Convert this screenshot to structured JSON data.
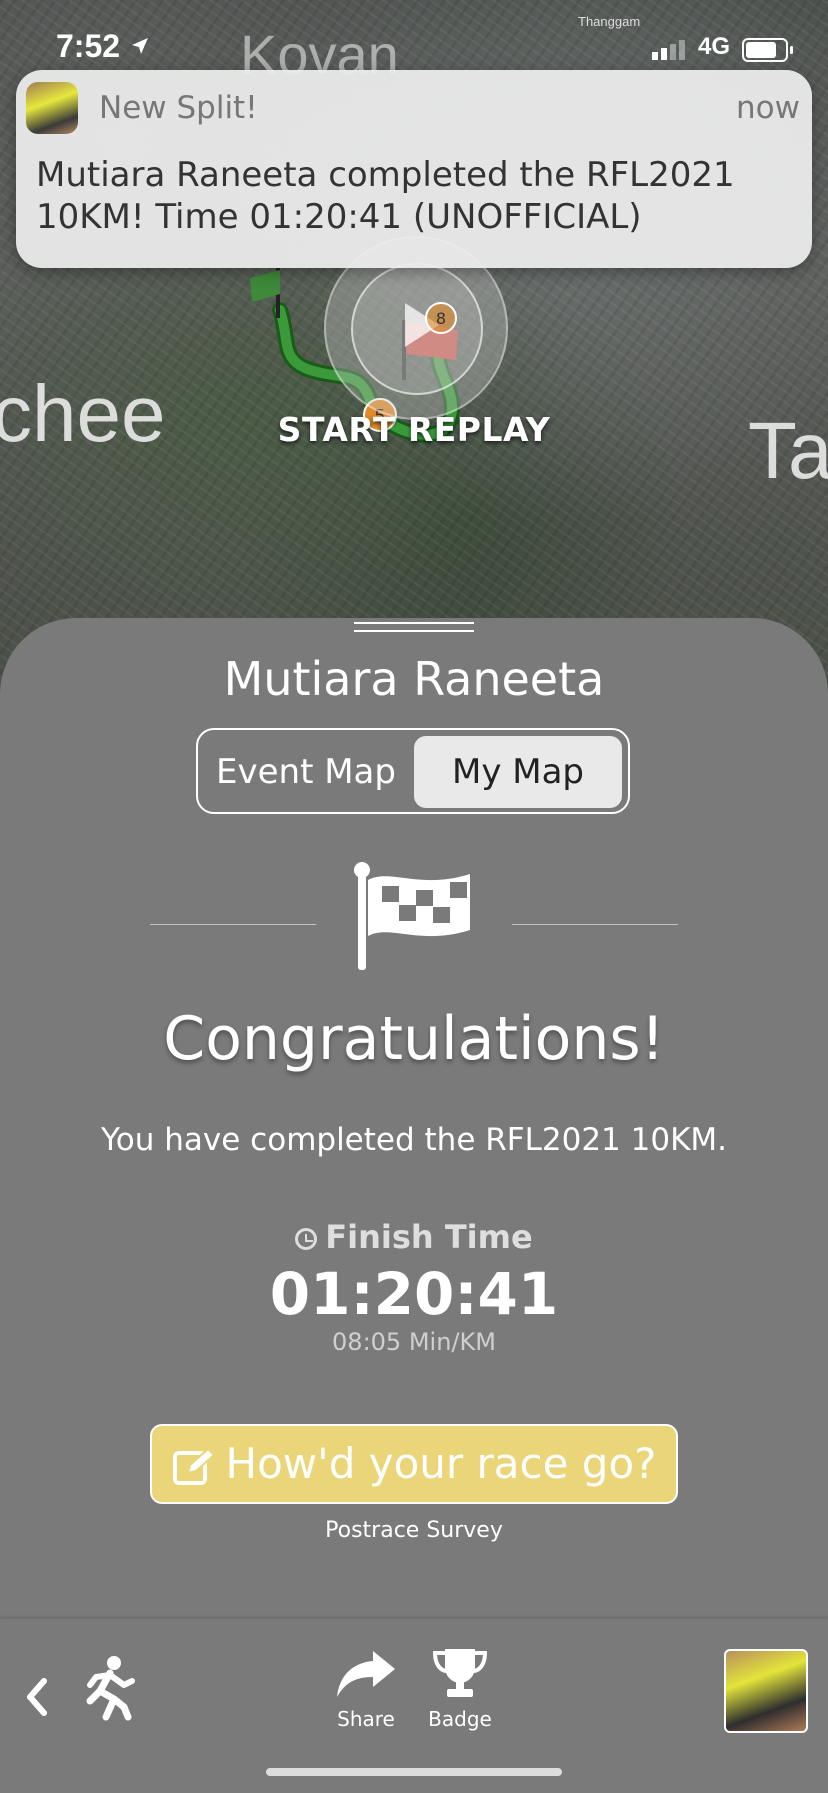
{
  "status_bar": {
    "time": "7:52",
    "network": "4G"
  },
  "map": {
    "labels": {
      "kovan": "Kovan",
      "chee": "chee",
      "ta": "Ta",
      "thanggam": "Thanggam"
    },
    "route_markers": [
      "5",
      "8"
    ],
    "start_replay_label": "START REPLAY"
  },
  "notification": {
    "app_title": "New Split!",
    "time": "now",
    "message": "Mutiara Raneeta completed the RFL2021 10KM! Time 01:20:41 (UNOFFICIAL)"
  },
  "sheet": {
    "runner_name": "Mutiara Raneeta",
    "toggle": {
      "event_map": "Event Map",
      "my_map": "My Map",
      "selected": "My Map"
    },
    "congrats_title": "Congratulations!",
    "completed_text": "You have completed the RFL2021 10KM.",
    "finish_time_label": "Finish Time",
    "finish_time": "01:20:41",
    "pace": "08:05 Min/KM",
    "survey_button": "How'd your race go?",
    "survey_sub": "Postrace Survey"
  },
  "tab_bar": {
    "share_label": "Share",
    "badge_label": "Badge"
  },
  "colors": {
    "sheet_bg": "#7a7a7a",
    "survey_btn": "#ead579",
    "route_green": "#3a9a3a",
    "finish_flag": "#d6453a"
  },
  "icons": [
    "location-arrow-icon",
    "signal-icon",
    "battery-icon",
    "play-icon",
    "checkered-flag-icon",
    "clock-icon",
    "edit-icon",
    "back-chevron-icon",
    "runner-icon",
    "share-icon",
    "trophy-icon"
  ]
}
